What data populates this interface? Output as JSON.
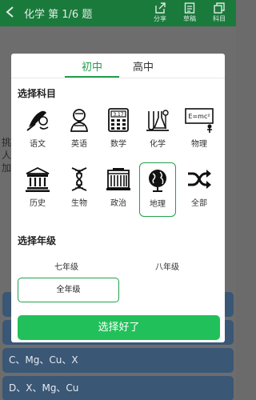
{
  "topbar": {
    "title": "化学  第 1/6 题",
    "share_label": "分享",
    "draft_label": "草稿",
    "subject_label": "科目"
  },
  "background": {
    "frag1": "挑",
    "frag2": "人",
    "frag3": "加",
    "options": [
      "",
      "",
      "C、Mg、Cu、X",
      "D、X、Mg、Cu"
    ]
  },
  "modal": {
    "tabs": [
      "初中",
      "高中"
    ],
    "active_tab": "初中",
    "subject_title": "选择科目",
    "subjects": [
      {
        "label": "语文",
        "icon": "pen-portrait-icon"
      },
      {
        "label": "英语",
        "icon": "shakespeare-icon"
      },
      {
        "label": "数学",
        "icon": "calculator-icon"
      },
      {
        "label": "化学",
        "icon": "lab-flask-icon"
      },
      {
        "label": "物理",
        "icon": "blackboard-formula-icon"
      },
      {
        "label": "历史",
        "icon": "temple-icon"
      },
      {
        "label": "生物",
        "icon": "dna-icon"
      },
      {
        "label": "政治",
        "icon": "building-icon"
      },
      {
        "label": "地理",
        "icon": "globe-icon"
      },
      {
        "label": "全部",
        "icon": "shuffle-icon"
      }
    ],
    "selected_subject": "地理",
    "blackboard_text": "E=mc²",
    "calculator_text": "3.17",
    "grade_title": "选择年级",
    "grades": [
      "七年级",
      "八年级",
      "全年级"
    ],
    "selected_grade": "全年级",
    "confirm_label": "选择好了"
  },
  "colors": {
    "accent": "#22a04c",
    "button": "#22c05a",
    "topbar": "#1a7a3c"
  }
}
